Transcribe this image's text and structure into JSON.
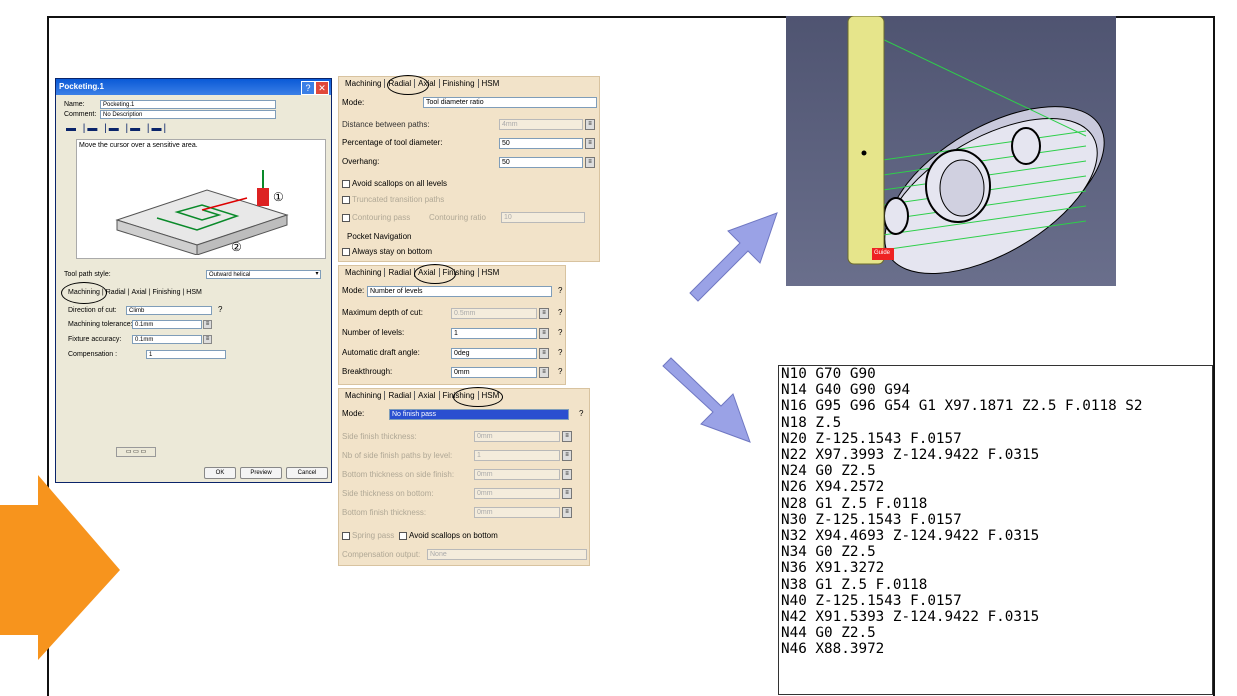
{
  "dialog": {
    "title": "Pocketing.1",
    "name_label": "Name:",
    "name_value": "Pocketing.1",
    "comment_label": "Comment:",
    "comment_value": "No Description",
    "hint": "Move the cursor over a sensitive area.",
    "callout_1": "①",
    "callout_2": "②",
    "toolpath_style_label": "Tool path style:",
    "toolpath_style_value": "Outward helical",
    "tabs": [
      "Machining",
      "Radial",
      "Axial",
      "Finishing",
      "HSM"
    ],
    "direction_label": "Direction of cut:",
    "direction_value": "Climb",
    "tolerance_label": "Machining tolerance:",
    "tolerance_value": "0.1mm",
    "fixture_label": "Fixture accuracy:",
    "fixture_value": "0.1mm",
    "compensation_label": "Compensation :",
    "compensation_value": "1",
    "ok_label": "OK",
    "preview_label": "Preview",
    "cancel_label": "Cancel"
  },
  "radial_panel": {
    "tabs": [
      "Machining",
      "Radial",
      "Axial",
      "Finishing",
      "HSM"
    ],
    "mode_label": "Mode:",
    "mode_value": "Tool diameter ratio",
    "distance_label": "Distance between paths:",
    "distance_value": "4mm",
    "percentage_label": "Percentage of tool diameter:",
    "percentage_value": "50",
    "overhang_label": "Overhang:",
    "overhang_value": "50",
    "avoid_scallops_label": "Avoid scallops on all levels",
    "truncated_label": "Truncated transition paths",
    "contouring_label": "Contouring pass",
    "contouring_ratio_label": "Contouring ratio",
    "contouring_ratio_value": "10",
    "pocket_nav_label": "Pocket Navigation",
    "always_bottom_label": "Always stay on bottom"
  },
  "axial_panel": {
    "tabs": [
      "Machining",
      "Radial",
      "Axial",
      "Finishing",
      "HSM"
    ],
    "mode_label": "Mode:",
    "mode_value": "Number of levels",
    "max_depth_label": "Maximum depth of cut:",
    "max_depth_value": "0.5mm",
    "num_levels_label": "Number of levels:",
    "num_levels_value": "1",
    "draft_label": "Automatic draft angle:",
    "draft_value": "0deg",
    "breakthrough_label": "Breakthrough:",
    "breakthrough_value": "0mm"
  },
  "finishing_panel": {
    "tabs": [
      "Machining",
      "Radial",
      "Axial",
      "Finishing",
      "HSM"
    ],
    "mode_label": "Mode:",
    "mode_value": "No finish pass",
    "side_thickness_label": "Side finish thickness:",
    "side_thickness_value": "0mm",
    "nb_paths_label": "Nb of side finish paths by level:",
    "nb_paths_value": "1",
    "bottom_on_side_label": "Bottom thickness on side finish:",
    "bottom_on_side_value": "0mm",
    "side_on_bottom_label": "Side thickness on bottom:",
    "side_on_bottom_value": "0mm",
    "bottom_finish_label": "Bottom finish thickness:",
    "bottom_finish_value": "0mm",
    "spring_label": "Spring pass",
    "avoid_bottom_label": "Avoid scallops on bottom",
    "comp_output_label": "Compensation output:",
    "comp_output_value": "None"
  },
  "viewport": {
    "guide_label": "Guide"
  },
  "gcode": [
    "N10 G70 G90",
    "N14 G40 G90 G94",
    "N16 G95 G96 G54 G1 X97.1871 Z2.5 F.0118 S2",
    "N18 Z.5",
    "N20 Z-125.1543 F.0157",
    "N22 X97.3993 Z-124.9422 F.0315",
    "N24 G0 Z2.5",
    "N26 X94.2572",
    "N28 G1 Z.5 F.0118",
    "N30 Z-125.1543 F.0157",
    "N32 X94.4693 Z-124.9422 F.0315",
    "N34 G0 Z2.5",
    "N36 X91.3272",
    "N38 G1 Z.5 F.0118",
    "N40 Z-125.1543 F.0157",
    "N42 X91.5393 Z-124.9422 F.0315",
    "N44 G0 Z2.5",
    "N46 X88.3972"
  ],
  "colors": {
    "orange_arrow": "#f7941d",
    "blue_arrow": "#9aa2e6",
    "panel_bg": "#f2e3c9",
    "viewport_bg": "#5a5f7a"
  }
}
